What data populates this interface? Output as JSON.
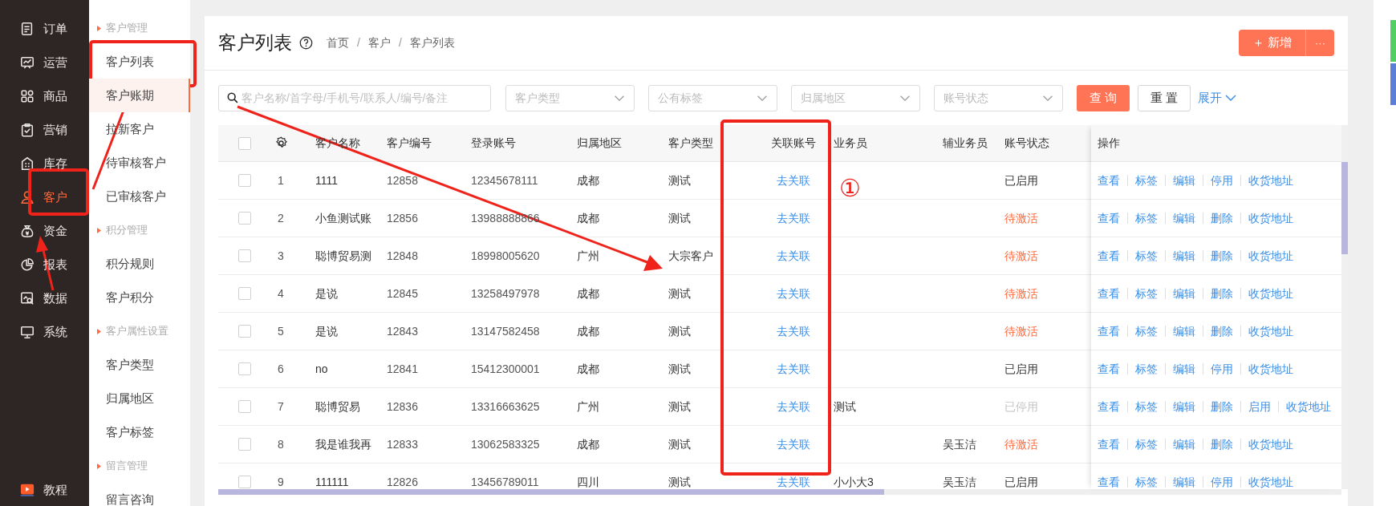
{
  "sidebar": {
    "items": [
      {
        "label": "订单",
        "selected": false
      },
      {
        "label": "运营",
        "selected": false
      },
      {
        "label": "商品",
        "selected": false
      },
      {
        "label": "营销",
        "selected": false
      },
      {
        "label": "库存",
        "selected": false
      },
      {
        "label": "客户",
        "selected": true
      },
      {
        "label": "资金",
        "selected": false
      },
      {
        "label": "报表",
        "selected": false
      },
      {
        "label": "数据",
        "selected": false
      },
      {
        "label": "系统",
        "selected": false
      }
    ],
    "footer": {
      "label": "教程"
    }
  },
  "submenu": [
    {
      "kind": "group",
      "label": "客户管理"
    },
    {
      "kind": "item",
      "label": "客户列表",
      "selected": false
    },
    {
      "kind": "item",
      "label": "客户账期",
      "selected": true
    },
    {
      "kind": "item",
      "label": "拉新客户",
      "selected": false
    },
    {
      "kind": "item",
      "label": "待审核客户",
      "selected": false
    },
    {
      "kind": "item",
      "label": "已审核客户",
      "selected": false
    },
    {
      "kind": "group",
      "label": "积分管理"
    },
    {
      "kind": "item",
      "label": "积分规则",
      "selected": false
    },
    {
      "kind": "item",
      "label": "客户积分",
      "selected": false
    },
    {
      "kind": "group",
      "label": "客户属性设置"
    },
    {
      "kind": "item",
      "label": "客户类型",
      "selected": false
    },
    {
      "kind": "item",
      "label": "归属地区",
      "selected": false
    },
    {
      "kind": "item",
      "label": "客户标签",
      "selected": false
    },
    {
      "kind": "group",
      "label": "留言管理"
    },
    {
      "kind": "item",
      "label": "留言咨询",
      "selected": false
    }
  ],
  "page": {
    "title": "客户列表",
    "breadcrumb": [
      "首页",
      "客户",
      "客户列表"
    ],
    "breadcrumb_separator": "/",
    "add_button": "＋ 新增",
    "more_button": "···"
  },
  "filters": {
    "search": {
      "placeholder": "客户名称/首字母/手机号/联系人/编号/备注"
    },
    "selects": [
      {
        "placeholder": "客户类型"
      },
      {
        "placeholder": "公有标签"
      },
      {
        "placeholder": "归属地区"
      },
      {
        "placeholder": "账号状态"
      }
    ],
    "query_button": "查 询",
    "reset_button": "重 置",
    "expand_link": "展开"
  },
  "table": {
    "select_all_checked": false,
    "columns": [
      "客户名称",
      "客户编号",
      "登录账号",
      "归属地区",
      "客户类型",
      "关联账号",
      "业务员",
      "辅业务员",
      "账号状态"
    ],
    "actions_column": "操作",
    "rows": [
      {
        "checked": false,
        "index": "1",
        "name": "1111",
        "id": "12858",
        "login": "12345678111",
        "region": "成都",
        "type": "测试",
        "link": "去关联",
        "sales": "",
        "assistant": "",
        "status": {
          "text": "已启用",
          "kind": "enabled"
        },
        "actions": [
          "查看",
          "标签",
          "编辑",
          "停用",
          "收货地址"
        ]
      },
      {
        "checked": false,
        "index": "2",
        "name": "小鱼测试账",
        "id": "12856",
        "login": "13988888866",
        "region": "成都",
        "type": "测试",
        "link": "去关联",
        "sales": "",
        "assistant": "",
        "status": {
          "text": "待激活",
          "kind": "pending"
        },
        "actions": [
          "查看",
          "标签",
          "编辑",
          "删除",
          "收货地址"
        ]
      },
      {
        "checked": false,
        "index": "3",
        "name": "聪博贸易测",
        "id": "12848",
        "login": "18998005620",
        "region": "广州",
        "type": "大宗客户",
        "link": "去关联",
        "sales": "",
        "assistant": "",
        "status": {
          "text": "待激活",
          "kind": "pending"
        },
        "actions": [
          "查看",
          "标签",
          "编辑",
          "删除",
          "收货地址"
        ]
      },
      {
        "checked": false,
        "index": "4",
        "name": "是说",
        "id": "12845",
        "login": "13258497978",
        "region": "成都",
        "type": "测试",
        "link": "去关联",
        "sales": "",
        "assistant": "",
        "status": {
          "text": "待激活",
          "kind": "pending"
        },
        "actions": [
          "查看",
          "标签",
          "编辑",
          "删除",
          "收货地址"
        ]
      },
      {
        "checked": false,
        "index": "5",
        "name": "是说",
        "id": "12843",
        "login": "13147582458",
        "region": "成都",
        "type": "测试",
        "link": "去关联",
        "sales": "",
        "assistant": "",
        "status": {
          "text": "待激活",
          "kind": "pending"
        },
        "actions": [
          "查看",
          "标签",
          "编辑",
          "删除",
          "收货地址"
        ]
      },
      {
        "checked": false,
        "index": "6",
        "name": "no",
        "id": "12841",
        "login": "15412300001",
        "region": "成都",
        "type": "测试",
        "link": "去关联",
        "sales": "",
        "assistant": "",
        "status": {
          "text": "已启用",
          "kind": "enabled"
        },
        "actions": [
          "查看",
          "标签",
          "编辑",
          "停用",
          "收货地址"
        ]
      },
      {
        "checked": false,
        "index": "7",
        "name": "聪博贸易",
        "id": "12836",
        "login": "13316663625",
        "region": "广州",
        "type": "测试",
        "link": "去关联",
        "sales": "测试",
        "assistant": "",
        "status": {
          "text": "已停用",
          "kind": "disabled"
        },
        "actions": [
          "查看",
          "标签",
          "编辑",
          "删除",
          "启用",
          "收货地址"
        ]
      },
      {
        "checked": false,
        "index": "8",
        "name": "我是谁我再",
        "id": "12833",
        "login": "13062583325",
        "region": "成都",
        "type": "测试",
        "link": "去关联",
        "sales": "",
        "assistant": "吴玉洁",
        "status": {
          "text": "待激活",
          "kind": "pending"
        },
        "actions": [
          "查看",
          "标签",
          "编辑",
          "删除",
          "收货地址"
        ]
      },
      {
        "checked": false,
        "index": "9",
        "name": "111111",
        "id": "12826",
        "login": "13456789011",
        "region": "四川",
        "type": "测试",
        "link": "去关联",
        "sales": "小小大3",
        "assistant": "吴玉洁",
        "status": {
          "text": "已启用",
          "kind": "enabled"
        },
        "actions": [
          "查看",
          "标签",
          "编辑",
          "停用",
          "收货地址"
        ]
      }
    ]
  },
  "annotation_label": "①"
}
